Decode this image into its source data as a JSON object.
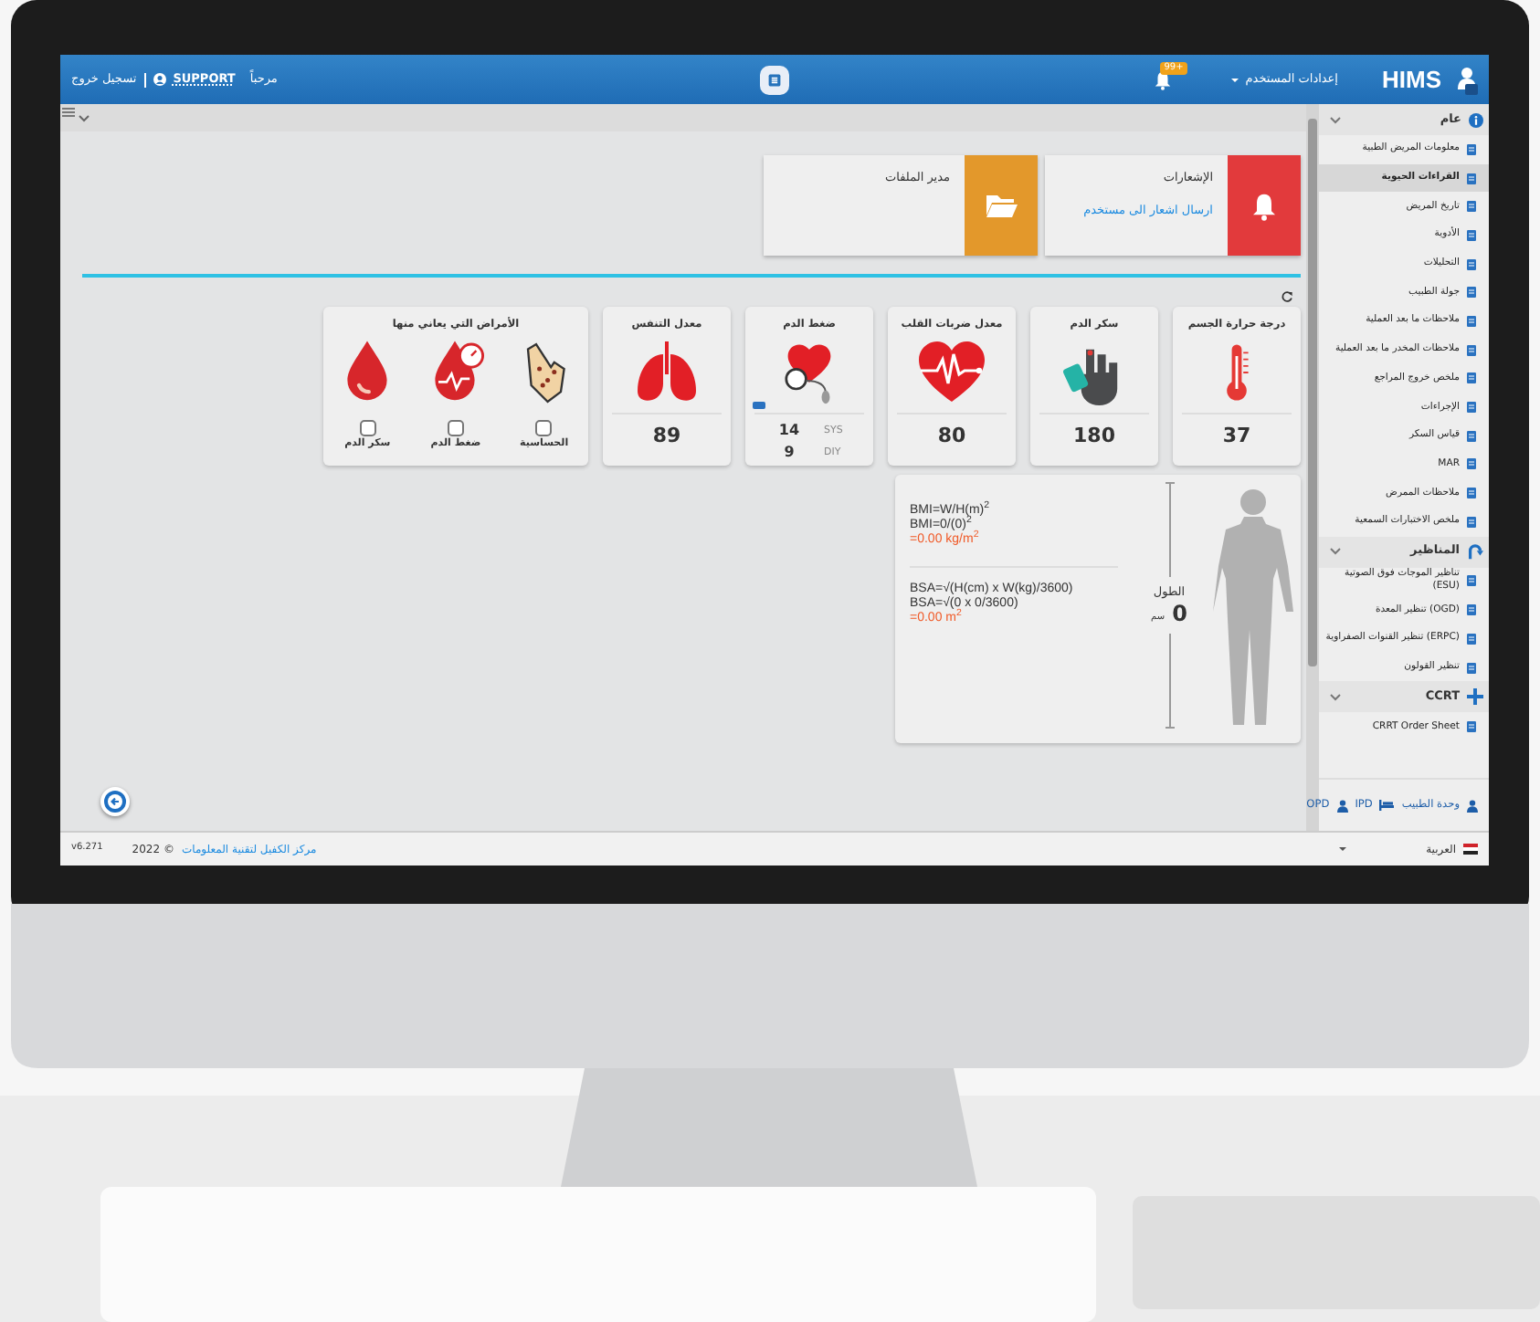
{
  "topbar": {
    "logout": "تسجيل خروج",
    "user": "SUPPORT",
    "greeting": "مرحباً",
    "notification_badge": "99+",
    "user_settings": "إعدادات المستخدم",
    "logo": "HIMS"
  },
  "shortcut_cards": [
    {
      "kind": "notifications",
      "title": "الإشعارات",
      "link": "ارسال اشعار الى مستخدم",
      "color": "#e23a3c"
    },
    {
      "kind": "files",
      "title": "مدير الملفات",
      "color": "#e3982b"
    }
  ],
  "vitals": [
    {
      "kind": "temperature",
      "title": "درجة حرارة الجسم",
      "value": "37"
    },
    {
      "kind": "sugar",
      "title": "سكر الدم",
      "value": "180"
    },
    {
      "kind": "heart_rate",
      "title": "معدل ضربات القلب",
      "value": "80"
    },
    {
      "kind": "blood_pressure",
      "title": "ضغط الدم",
      "readings": [
        {
          "label": "SYS",
          "value": "14"
        },
        {
          "label": "DIY",
          "value": "9"
        }
      ]
    },
    {
      "kind": "respiration",
      "title": "معدل التنفس",
      "value": "89"
    }
  ],
  "diseases": {
    "title": "الأمراض التي يعاني منها",
    "items": [
      {
        "kind": "allergy",
        "label": "الحساسية",
        "checked": false
      },
      {
        "kind": "pressure",
        "label": "ضغط الدم",
        "checked": false
      },
      {
        "kind": "sugar",
        "label": "سكر الدم",
        "checked": false
      }
    ]
  },
  "body_measures": {
    "bmi_lines": [
      "BMI=W/H(m)$^{2}$",
      "BMI=0/(0)$^{2}$"
    ],
    "bmi_result": "=0.00 kg/m$^{2}$",
    "bsa_lines": [
      "BSA=√(H(cm) x W(kg)/3600)",
      "BSA=√(0 x 0/3600)"
    ],
    "bsa_result": "=0.00 m$^{2}$",
    "height_label": "الطول",
    "height_value": "0",
    "height_unit": "سم"
  },
  "sidebar": {
    "groups": [
      {
        "kind": "info",
        "title": "عام",
        "expanded": true,
        "items": [
          {
            "label": "معلومات المريض الطبية",
            "selected": false
          },
          {
            "label": "القراءات الحيوية",
            "selected": true
          },
          {
            "label": "تاريخ المريض",
            "selected": false
          },
          {
            "label": "الأدوية",
            "selected": false
          },
          {
            "label": "التحليلات",
            "selected": false
          },
          {
            "label": "جولة الطبيب",
            "selected": false
          },
          {
            "label": "ملاحظات ما بعد العملية",
            "selected": false
          },
          {
            "label": "ملاحظات المخدر ما بعد العملية",
            "selected": false
          },
          {
            "label": "ملخص خروج المراجع",
            "selected": false
          },
          {
            "label": "الإجراءات",
            "selected": false
          },
          {
            "label": "قياس السكر",
            "selected": false
          },
          {
            "label": "MAR",
            "selected": false
          },
          {
            "label": "ملاحظات الممرض",
            "selected": false
          },
          {
            "label": "ملخص الاختبارات السمعية",
            "selected": false
          }
        ]
      },
      {
        "kind": "scope",
        "title": "المناظير",
        "expanded": true,
        "items": [
          {
            "label": "تناظير الموجات فوق الصوتية (ESU)",
            "selected": false
          },
          {
            "label": "تنظير المعدة (OGD)",
            "selected": false
          },
          {
            "label": "تنظير القنوات الصفراوية (ERPC)",
            "selected": false
          },
          {
            "label": "تنظير القولون",
            "selected": false
          }
        ]
      },
      {
        "kind": "plus",
        "title": "CCRT",
        "expanded": true,
        "items": [
          {
            "label": "CRRT Order Sheet",
            "selected": false
          }
        ]
      }
    ],
    "tabs": [
      {
        "kind": "doctor",
        "label": "وحدة الطبيب"
      },
      {
        "kind": "ipd",
        "label": "IPD"
      },
      {
        "kind": "opd",
        "label": "OPD"
      }
    ]
  },
  "footer": {
    "version": "v6.271",
    "copyright": "2022 ©",
    "company": "مركز الكفيل لتقنية المعلومات",
    "language": "العربية"
  }
}
